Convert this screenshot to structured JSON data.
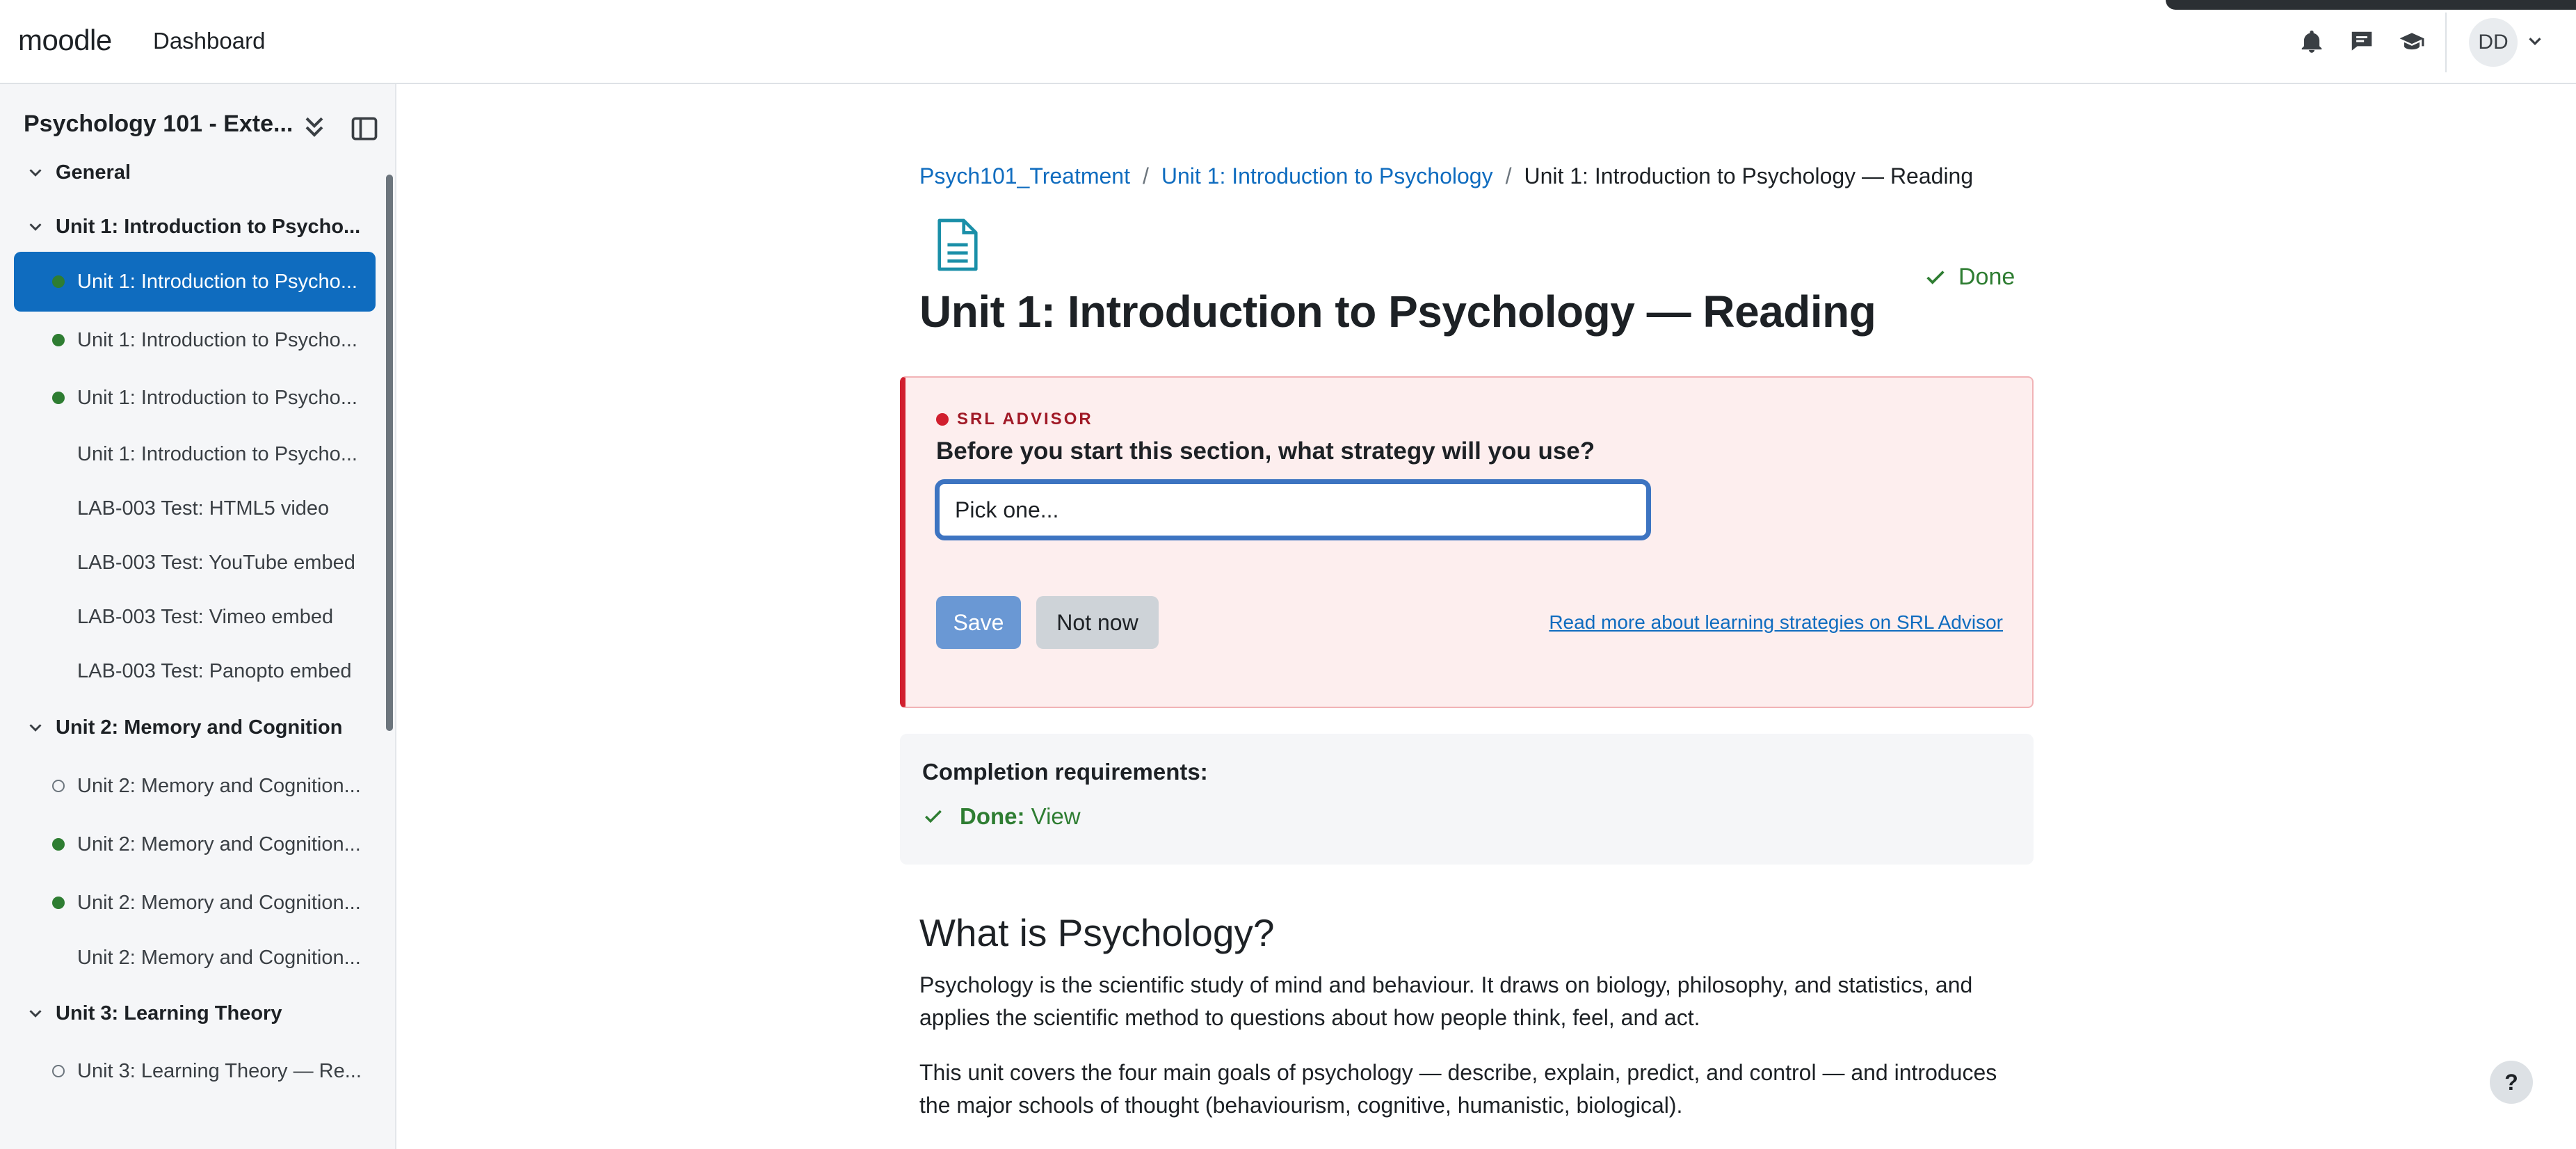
{
  "navbar": {
    "brand": "moodle",
    "dashboard_link": "Dashboard",
    "icons": [
      "bell-icon",
      "chat-icon",
      "graduation-cap-icon"
    ],
    "user_initials": "DD"
  },
  "drawer": {
    "course_title": "Psychology 101 - Exte...",
    "items": [
      {
        "type": "section",
        "label": "General"
      },
      {
        "type": "section",
        "label": "Unit 1: Introduction to Psycho..."
      },
      {
        "type": "item",
        "label": "Unit 1: Introduction to Psycho...",
        "status": "done",
        "active": true
      },
      {
        "type": "item",
        "label": "Unit 1: Introduction to Psycho...",
        "status": "done"
      },
      {
        "type": "item",
        "label": "Unit 1: Introduction to Psycho...",
        "status": "done"
      },
      {
        "type": "item",
        "label": "Unit 1: Introduction to Psycho...",
        "status": "none"
      },
      {
        "type": "item",
        "label": "LAB-003 Test: HTML5 video",
        "status": "none"
      },
      {
        "type": "item",
        "label": "LAB-003 Test: YouTube embed",
        "status": "none"
      },
      {
        "type": "item",
        "label": "LAB-003 Test: Vimeo embed",
        "status": "none"
      },
      {
        "type": "item",
        "label": "LAB-003 Test: Panopto embed",
        "status": "none"
      },
      {
        "type": "section",
        "label": "Unit 2: Memory and Cognition"
      },
      {
        "type": "item",
        "label": "Unit 2: Memory and Cognition...",
        "status": "pending"
      },
      {
        "type": "item",
        "label": "Unit 2: Memory and Cognition...",
        "status": "done"
      },
      {
        "type": "item",
        "label": "Unit 2: Memory and Cognition...",
        "status": "done"
      },
      {
        "type": "item",
        "label": "Unit 2: Memory and Cognition...",
        "status": "none"
      },
      {
        "type": "section",
        "label": "Unit 3: Learning Theory"
      },
      {
        "type": "item",
        "label": "Unit 3: Learning Theory — Re...",
        "status": "pending"
      }
    ]
  },
  "breadcrumb": {
    "items": [
      "Psych101_Treatment",
      "Unit 1: Introduction to Psychology"
    ],
    "current": "Unit 1: Introduction to Psychology — Reading",
    "separator": "/"
  },
  "page": {
    "title": "Unit 1: Introduction to Psychology — Reading",
    "done_label": "Done"
  },
  "advisor": {
    "tag": "SRL ADVISOR",
    "question": "Before you start this section, what strategy will you use?",
    "select_value": "Pick one...",
    "save_label": "Save",
    "not_now_label": "Not now",
    "read_more": "Read more about learning strategies on SRL Advisor"
  },
  "completion": {
    "title": "Completion requirements:",
    "status": "Done:",
    "requirement": "View"
  },
  "content": {
    "heading": "What is Psychology?",
    "paragraph1": "Psychology is the scientific study of mind and behaviour. It draws on biology, philosophy, and statistics, and applies the scientific method to questions about how people think, feel, and act.",
    "paragraph2": "This unit covers the four main goals of psychology — describe, explain, predict, and control — and introduces the major schools of thought (behaviourism, cognitive, humanistic, biological)."
  },
  "help": {
    "label": "?"
  },
  "colors": {
    "accent": "#0f6cbf",
    "success": "#2e7d32",
    "advisor_border": "#d11f2e",
    "advisor_bg": "#fdeeee"
  }
}
